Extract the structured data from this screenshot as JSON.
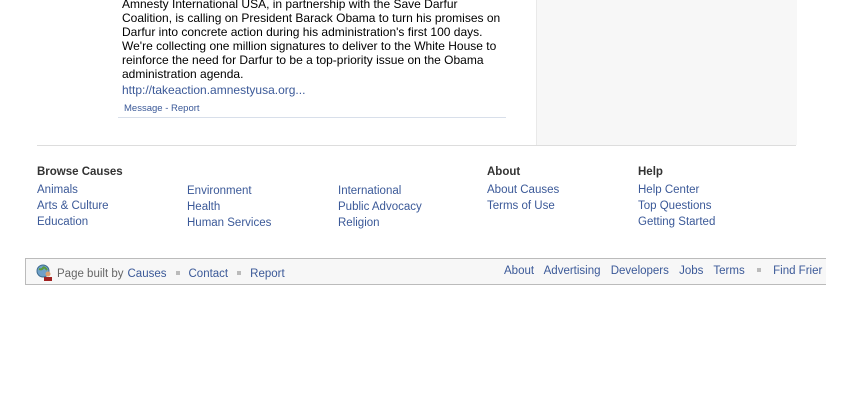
{
  "post": {
    "body": "Amnesty International USA, in partnership with the Save Darfur Coalition, is calling on President Barack Obama to turn his promises on Darfur into concrete action during his administration's first 100 days. We're collecting one million signatures to deliver to the White House to reinforce the need for Darfur to be a top-priority issue on the Obama administration agenda.",
    "link": "http://takeaction.amnestyusa.org...",
    "message": "Message",
    "sep": "-",
    "report": "Report"
  },
  "browse": {
    "title": "Browse Causes",
    "col1": [
      "Animals",
      "Arts & Culture",
      "Education"
    ],
    "col2": [
      "Environment",
      "Health",
      "Human Services"
    ],
    "col3": [
      "International",
      "Public Advocacy",
      "Religion"
    ]
  },
  "about": {
    "title": "About",
    "items": [
      "About Causes",
      "Terms of Use"
    ]
  },
  "help": {
    "title": "Help",
    "items": [
      "Help Center",
      "Top Questions",
      "Getting Started"
    ]
  },
  "footer": {
    "built_by": "Page built by",
    "causes": "Causes",
    "contact": "Contact",
    "report": "Report",
    "links": [
      "About",
      "Advertising",
      "Developers",
      "Jobs",
      "Terms"
    ],
    "find_friends": "Find Frier"
  }
}
